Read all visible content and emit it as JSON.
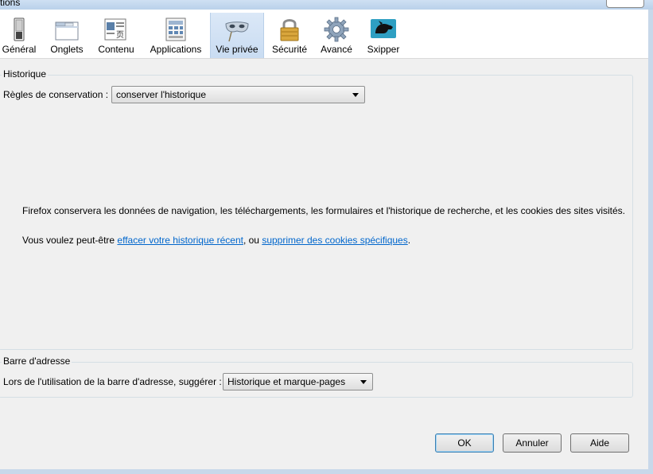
{
  "window": {
    "title": "tions"
  },
  "toolbar": {
    "items": [
      {
        "label": "Général",
        "icon": "general-switch-icon"
      },
      {
        "label": "Onglets",
        "icon": "tabs-window-icon"
      },
      {
        "label": "Contenu",
        "icon": "content-page-icon"
      },
      {
        "label": "Applications",
        "icon": "applications-icon"
      },
      {
        "label": "Vie privée",
        "icon": "privacy-mask-icon"
      },
      {
        "label": "Sécurité",
        "icon": "padlock-icon"
      },
      {
        "label": "Avancé",
        "icon": "gear-icon"
      },
      {
        "label": "Sxipper",
        "icon": "sxipper-dog-icon"
      }
    ],
    "selected_index": 4
  },
  "history": {
    "group_title": "Historique",
    "rules_label": "Règles de conservation :",
    "rules_value": "conserver l'historique",
    "info_text": "Firefox conservera les données de navigation, les téléchargements, les formulaires et l'historique de recherche, et les cookies des sites visités.",
    "suggestion_prefix": "Vous voulez peut-être ",
    "link_clear_history": "effacer votre historique récent",
    "suggestion_middle": ", ou ",
    "link_remove_cookies": "supprimer des cookies spécifiques",
    "suggestion_suffix": "."
  },
  "address_bar": {
    "group_title": "Barre d'adresse",
    "suggest_label": "Lors de l'utilisation de la barre d'adresse, suggérer :",
    "suggest_value": "Historique et marque-pages"
  },
  "buttons": {
    "ok": "OK",
    "cancel": "Annuler",
    "help": "Aide"
  },
  "colors": {
    "link": "#0066cc",
    "selected_tab": "#c9dcf2"
  }
}
